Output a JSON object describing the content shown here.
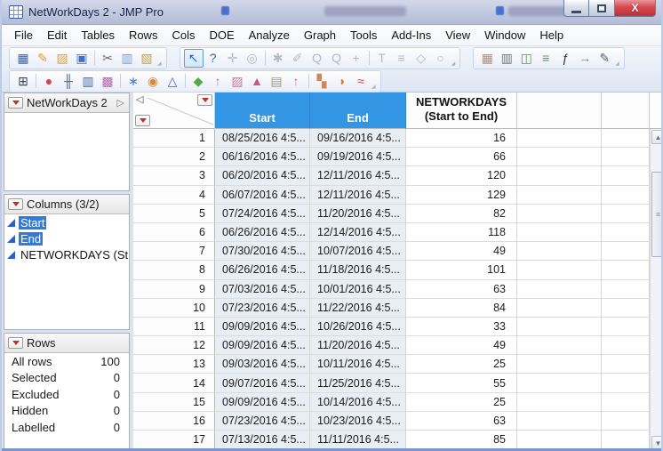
{
  "window": {
    "title": "NetWorkDays 2 - JMP Pro",
    "close_glyph": "X"
  },
  "menu": {
    "items": [
      "File",
      "Edit",
      "Tables",
      "Rows",
      "Cols",
      "DOE",
      "Analyze",
      "Graph",
      "Tools",
      "Add-Ins",
      "View",
      "Window",
      "Help"
    ]
  },
  "toolbar_row1": {
    "file_group": [
      {
        "name": "new-data-table-icon",
        "glyph": "▦",
        "color": "#2f62c4"
      },
      {
        "name": "new-journal-icon",
        "glyph": "✎",
        "color": "#d89a3a"
      },
      {
        "name": "open-icon",
        "glyph": "▨",
        "color": "#e0a53c"
      },
      {
        "name": "save-icon",
        "glyph": "▣",
        "color": "#3b6fd0"
      },
      {
        "sep": true
      },
      {
        "name": "cut-icon",
        "glyph": "✂",
        "color": "#666666"
      },
      {
        "name": "copy-icon",
        "glyph": "▥",
        "color": "#7a9cd8"
      },
      {
        "name": "paste-icon",
        "glyph": "▧",
        "color": "#c8a24a"
      }
    ],
    "tools_group": [
      {
        "name": "arrow-tool-icon",
        "glyph": "↖",
        "color": "#2f62c4",
        "selected": true
      },
      {
        "name": "help-tool-icon",
        "glyph": "?",
        "color": "#2f62c4"
      },
      {
        "name": "crosshair-tool-icon",
        "glyph": "✛",
        "color": "#9aa7bb",
        "disabled": true
      },
      {
        "name": "target-tool-icon",
        "glyph": "◎",
        "color": "#9aa7bb",
        "disabled": true
      },
      {
        "sep": true
      },
      {
        "name": "hand-tool-icon",
        "glyph": "✱",
        "color": "#9aa7bb",
        "disabled": true
      },
      {
        "name": "brush-tool-icon",
        "glyph": "✐",
        "color": "#9aa7bb",
        "disabled": true
      },
      {
        "name": "zoom-out-tool-icon",
        "glyph": "Q",
        "color": "#9aa7bb",
        "disabled": true
      },
      {
        "name": "zoom-in-tool-icon",
        "glyph": "Q",
        "color": "#9aa7bb",
        "disabled": true
      },
      {
        "name": "plus-tool-icon",
        "glyph": "+",
        "color": "#9aa7bb",
        "disabled": true
      },
      {
        "sep": true
      },
      {
        "name": "text-annotate-tool-icon",
        "glyph": "T",
        "color": "#9aa7bb",
        "disabled": true
      },
      {
        "name": "line-annotate-tool-icon",
        "glyph": "≡",
        "color": "#9aa7bb",
        "disabled": true
      },
      {
        "name": "polygon-tool-icon",
        "glyph": "◇",
        "color": "#9aa7bb",
        "disabled": true
      },
      {
        "name": "oval-tool-icon",
        "glyph": "○",
        "color": "#9aa7bb",
        "disabled": true
      }
    ],
    "table_group": [
      {
        "name": "data-table-icon",
        "glyph": "▦",
        "color": "#dd8833"
      },
      {
        "name": "summary-icon",
        "glyph": "▥",
        "color": "#667788"
      },
      {
        "name": "split-table-icon",
        "glyph": "◫",
        "color": "#44aa44"
      },
      {
        "name": "sort-icon",
        "glyph": "≡",
        "color": "#44aa44"
      },
      {
        "name": "formula-icon",
        "glyph": "ƒ",
        "color": "#223355"
      },
      {
        "name": "join-icon",
        "glyph": "→",
        "color": "#44aa44"
      },
      {
        "name": "recode-icon",
        "glyph": "✎",
        "color": "#556677"
      }
    ]
  },
  "toolbar_row2": {
    "analyze_group": [
      {
        "name": "data-grid-icon",
        "glyph": "⊞",
        "color": "#334455"
      },
      {
        "sep": true
      },
      {
        "name": "distribution-icon",
        "glyph": "●",
        "color": "#cc4455"
      },
      {
        "name": "fit-y-by-x-icon",
        "glyph": "╫",
        "color": "#446688"
      },
      {
        "name": "matched-pairs-icon",
        "glyph": "▥",
        "color": "#4466aa"
      },
      {
        "name": "multivariate-icon",
        "glyph": "▩",
        "color": "#bb66aa"
      },
      {
        "sep": true
      },
      {
        "name": "scatter-burst-icon",
        "glyph": "∗",
        "color": "#5577cc"
      },
      {
        "name": "bubble-plot-icon",
        "glyph": "◉",
        "color": "#dd8833"
      },
      {
        "name": "ternary-plot-icon",
        "glyph": "△",
        "color": "#3366cc"
      },
      {
        "sep": true
      },
      {
        "name": "graph-builder-icon",
        "glyph": "◆",
        "color": "#55aa44"
      },
      {
        "name": "tree-map-icon",
        "glyph": "↑",
        "color": "#cc7799"
      },
      {
        "name": "surface-plot-icon",
        "glyph": "▨",
        "color": "#cc7799"
      },
      {
        "name": "contour-plot-icon",
        "glyph": "▲",
        "color": "#cc5588"
      },
      {
        "name": "profiler-icon",
        "glyph": "▤",
        "color": "#bb9933"
      },
      {
        "name": "scatterplot-3d-icon",
        "glyph": "↑",
        "color": "#cc7799"
      },
      {
        "sep": true
      },
      {
        "name": "partition-icon",
        "glyph": "▚",
        "color": "#cc8855"
      },
      {
        "name": "pie-chart-icon",
        "glyph": "◑",
        "color": "#cc8833"
      },
      {
        "name": "control-chart-icon",
        "glyph": "≈",
        "color": "#cc4444"
      }
    ]
  },
  "sidebar": {
    "table_panel": {
      "title": "NetWorkDays 2",
      "collapse_glyph": "▷"
    },
    "columns_panel": {
      "title": "Columns (3/2)",
      "items": [
        {
          "label": "Start",
          "selected": true
        },
        {
          "label": "End",
          "selected": true
        },
        {
          "label": "NETWORKDAYS (St",
          "selected": false
        }
      ]
    },
    "rows_panel": {
      "title": "Rows",
      "stats": [
        {
          "label": "All rows",
          "value": "100"
        },
        {
          "label": "Selected",
          "value": "0"
        },
        {
          "label": "Excluded",
          "value": "0"
        },
        {
          "label": "Hidden",
          "value": "0"
        },
        {
          "label": "Labelled",
          "value": "0"
        }
      ]
    }
  },
  "table": {
    "header": {
      "corner_collapse_glyph": "◁",
      "start": "Start",
      "end": "End",
      "days_line1": "NETWORKDAYS",
      "days_line2": "(Start to End)"
    },
    "rows": [
      {
        "n": "1",
        "start": "08/25/2016 4:5...",
        "end": "09/16/2016 4:5...",
        "days": "16"
      },
      {
        "n": "2",
        "start": "06/16/2016 4:5...",
        "end": "09/19/2016 4:5...",
        "days": "66"
      },
      {
        "n": "3",
        "start": "06/20/2016 4:5...",
        "end": "12/11/2016 4:5...",
        "days": "120"
      },
      {
        "n": "4",
        "start": "06/07/2016 4:5...",
        "end": "12/11/2016 4:5...",
        "days": "129"
      },
      {
        "n": "5",
        "start": "07/24/2016 4:5...",
        "end": "11/20/2016 4:5...",
        "days": "82"
      },
      {
        "n": "6",
        "start": "06/26/2016 4:5...",
        "end": "12/14/2016 4:5...",
        "days": "118"
      },
      {
        "n": "7",
        "start": "07/30/2016 4:5...",
        "end": "10/07/2016 4:5...",
        "days": "49"
      },
      {
        "n": "8",
        "start": "06/26/2016 4:5...",
        "end": "11/18/2016 4:5...",
        "days": "101"
      },
      {
        "n": "9",
        "start": "07/03/2016 4:5...",
        "end": "10/01/2016 4:5...",
        "days": "63"
      },
      {
        "n": "10",
        "start": "07/23/2016 4:5...",
        "end": "11/22/2016 4:5...",
        "days": "84"
      },
      {
        "n": "11",
        "start": "09/09/2016 4:5...",
        "end": "10/26/2016 4:5...",
        "days": "33"
      },
      {
        "n": "12",
        "start": "09/09/2016 4:5...",
        "end": "11/20/2016 4:5...",
        "days": "49"
      },
      {
        "n": "13",
        "start": "09/03/2016 4:5...",
        "end": "10/11/2016 4:5...",
        "days": "25"
      },
      {
        "n": "14",
        "start": "09/07/2016 4:5...",
        "end": "11/25/2016 4:5...",
        "days": "55"
      },
      {
        "n": "15",
        "start": "09/09/2016 4:5...",
        "end": "10/14/2016 4:5...",
        "days": "25"
      },
      {
        "n": "16",
        "start": "07/23/2016 4:5...",
        "end": "10/23/2016 4:5...",
        "days": "63"
      },
      {
        "n": "17",
        "start": "07/13/2016 4:5...",
        "end": "11/11/2016 4:5...",
        "days": "85"
      }
    ]
  },
  "scrollbar": {
    "up_glyph": "▲",
    "down_glyph": "▼",
    "grip_glyph": "≡"
  }
}
